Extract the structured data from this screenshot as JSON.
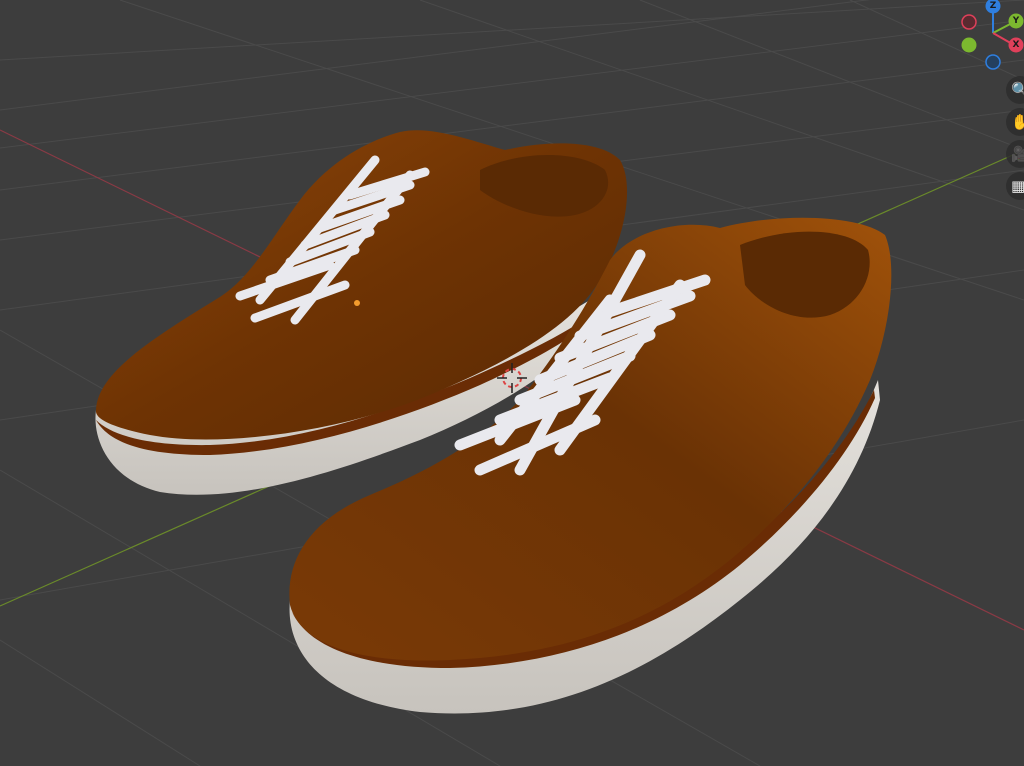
{
  "viewport": {
    "background": "#3d3d3d",
    "grid_line_color": "#4a4a4a",
    "x_axis_line_color": "#8a3a45",
    "y_axis_line_color": "#6a8a2a"
  },
  "object": {
    "name": "shoes",
    "upper_color": "#7a3a06",
    "sole_color": "#d8d4cf",
    "lace_color": "#e9e9ee",
    "stripe_color": "#6a2c05"
  },
  "gizmo": {
    "z_label": "Z",
    "y_label": "Y",
    "x_label": "X",
    "z_color": "#2f7fe0",
    "y_color": "#7cb82f",
    "x_color": "#e0405a"
  },
  "nav_tools": [
    {
      "icon": "zoom-icon",
      "glyph": "🔍"
    },
    {
      "icon": "pan-hand-icon",
      "glyph": "✋"
    },
    {
      "icon": "camera-icon",
      "glyph": "🎥"
    },
    {
      "icon": "perspective-grid-icon",
      "glyph": "▦"
    }
  ]
}
